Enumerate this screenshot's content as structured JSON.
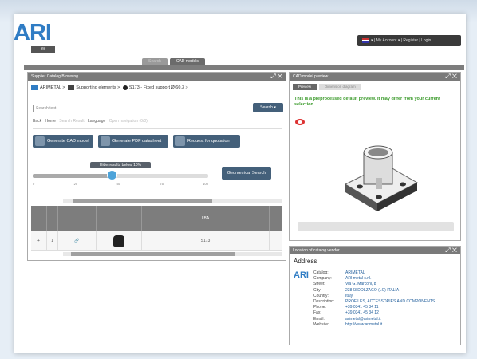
{
  "logo": {
    "text": "ARI",
    "sub": "m"
  },
  "topbar": {
    "text": "▾ | My Account ▾ | Register | Login"
  },
  "tabs": [
    {
      "label": "Search"
    },
    {
      "label": "CAD models"
    }
  ],
  "left": {
    "title": "Supplier Catalog Browsing",
    "crumbs": [
      "ARIMETAL",
      "Supporting elements",
      "S173 - Fixed support Ø 60,3"
    ],
    "search_placeholder": "Search text",
    "search_btn": "Search",
    "links": [
      "Back",
      "Home",
      "Search Result",
      "Language",
      "Open navigation (0/0)"
    ],
    "btn_cad": "Generate CAD model",
    "btn_pdf": "Generate PDF datasheet",
    "btn_quote": "Request for quotation",
    "tip": "Hide results below 10%",
    "slider": 0.45,
    "ticks": [
      "0",
      "25",
      "50",
      "75",
      "100"
    ],
    "geo": "Geometrical Search",
    "col_head": "LBA",
    "row": {
      "a": "+",
      "b": "1",
      "code": "S173"
    }
  },
  "preview": {
    "title": "CAD model preview",
    "tabs": [
      "Preview",
      "Dimension diagram"
    ],
    "note": "This is a preprocessed default preview. It may differ from your current selection."
  },
  "catalog": {
    "title": "Location of catalog vendor",
    "heading": "Address",
    "fields": [
      {
        "k": "Catalog:",
        "v": "ARIMETAL"
      },
      {
        "k": "Company:",
        "v": "ARI metal s.r.l."
      },
      {
        "k": "Street:",
        "v": "Via G. Marconi, 8"
      },
      {
        "k": "City:",
        "v": "23843 DOLZAGO (LC) ITALIA"
      },
      {
        "k": "Country:",
        "v": "Italy"
      },
      {
        "k": "Description:",
        "v": "PROFILES, ACCESSORIES AND COMPONENTS"
      },
      {
        "k": "Phone:",
        "v": "+39 0341 45 34 11"
      },
      {
        "k": "Fax:",
        "v": "+39 0341 45 34 12"
      },
      {
        "k": "Email:",
        "v": "arimetal@arimetal.it"
      },
      {
        "k": "Website:",
        "v": "http://www.arimetal.it"
      }
    ]
  },
  "colors": {
    "button": "#44607a",
    "accent": "#4da3d9",
    "note": "#3a9a2a",
    "link": "#1e5c9a"
  }
}
